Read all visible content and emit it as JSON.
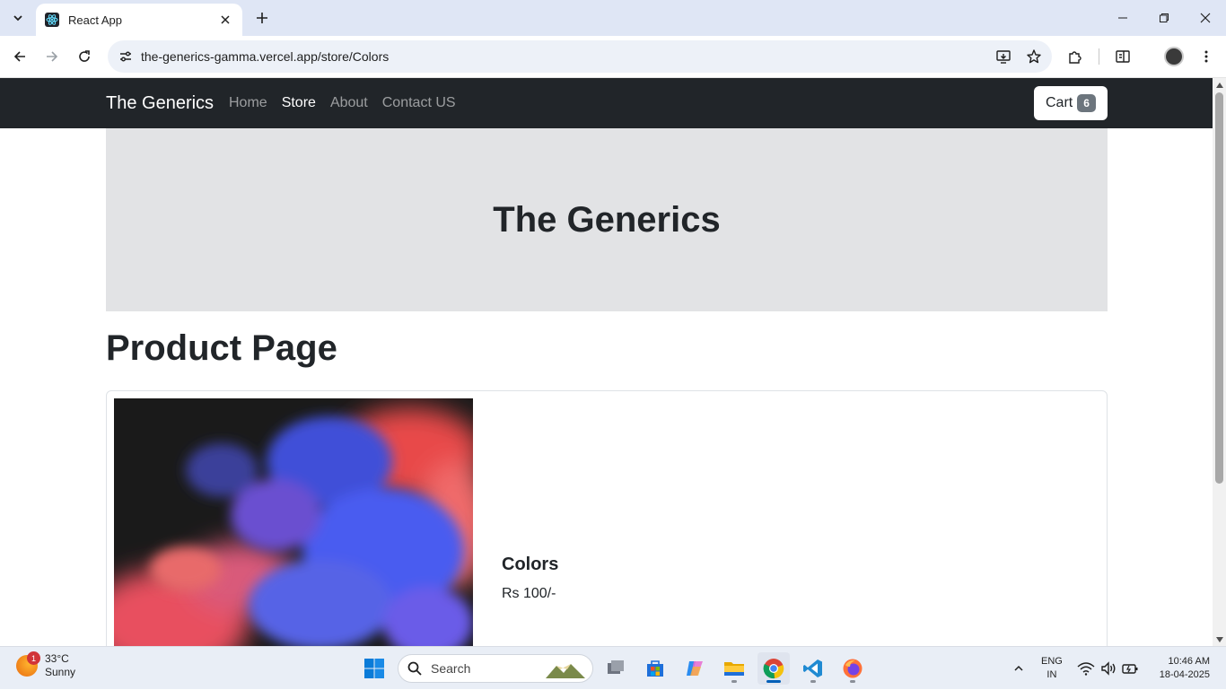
{
  "browser": {
    "tab_title": "React App",
    "url": "the-generics-gamma.vercel.app/store/Colors"
  },
  "site": {
    "brand": "The Generics",
    "nav_links": [
      "Home",
      "Store",
      "About",
      "Contact US"
    ],
    "active_link": "Store",
    "cart_label": "Cart",
    "cart_count": "6",
    "hero_title": "The Generics",
    "page_heading": "Product Page",
    "product": {
      "name": "Colors",
      "price": "Rs 100/-"
    }
  },
  "taskbar": {
    "weather_temp": "33°C",
    "weather_desc": "Sunny",
    "weather_badge": "1",
    "search_placeholder": "Search",
    "lang_line1": "ENG",
    "lang_line2": "IN",
    "time": "10:46 AM",
    "date": "18-04-2025"
  },
  "colors": {
    "navbar_bg": "#212529",
    "hero_bg": "#e2e3e5",
    "badge_bg": "#6c757d",
    "tabstrip_bg": "#dfe6f5",
    "taskbar_bg": "#e9eef6"
  },
  "icons": {
    "tab_favicon": "react-logo-icon",
    "taskbar_apps": [
      "windows-start-icon",
      "task-view-icon",
      "microsoft-store-icon",
      "copilot-icon",
      "file-explorer-icon",
      "chrome-icon",
      "vscode-icon",
      "firefox-icon"
    ]
  }
}
